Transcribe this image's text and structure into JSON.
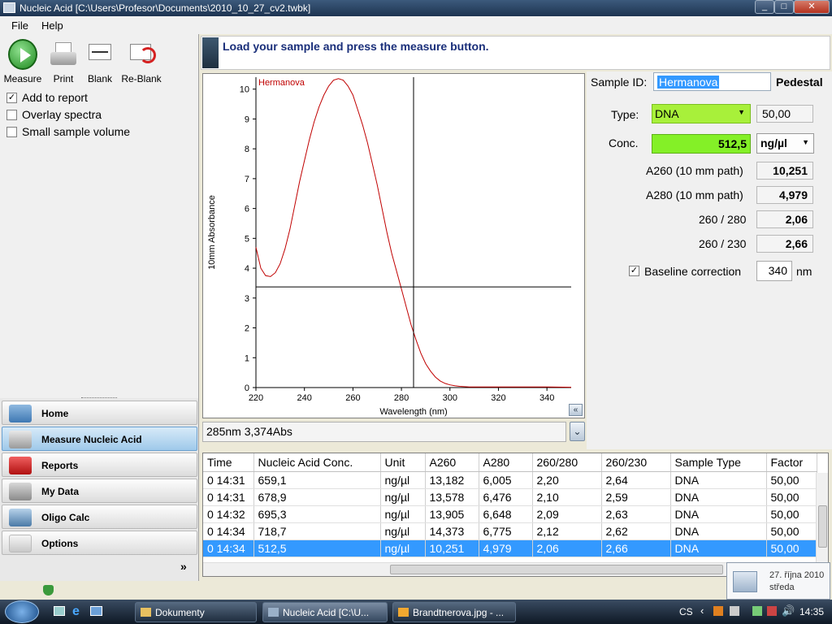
{
  "window": {
    "title": "Nucleic Acid  [C:\\Users\\Profesor\\Documents\\2010_10_27_cv2.twbk]",
    "min": "_",
    "max": "□",
    "close": "✕"
  },
  "menu": [
    "File",
    "Help"
  ],
  "toolbar": {
    "measure": "Measure",
    "print": "Print",
    "blank": "Blank",
    "reblank": "Re-Blank"
  },
  "options": [
    {
      "label": "Add to report",
      "checked": true
    },
    {
      "label": "Overlay spectra",
      "checked": false
    },
    {
      "label": "Small sample volume",
      "checked": false
    }
  ],
  "nav": [
    {
      "label": "Home",
      "active": false
    },
    {
      "label": "Measure Nucleic Acid",
      "active": true
    },
    {
      "label": "Reports",
      "active": false
    },
    {
      "label": "My Data",
      "active": false
    },
    {
      "label": "Oligo Calc",
      "active": false
    },
    {
      "label": "Options",
      "active": false
    }
  ],
  "nav_more": "»",
  "instruction": "Load your sample and press the measure button.",
  "readout": "285nm 3,374Abs",
  "sample": {
    "id_label": "Sample ID:",
    "id_value": "Hermanova",
    "pedestal": "Pedestal",
    "type_label": "Type:",
    "type_value": "DNA",
    "factor": "50,00",
    "conc_label": "Conc.",
    "conc_value": "512,5",
    "unit": "ng/µl",
    "a260_label": "A260 (10 mm path)",
    "a260": "10,251",
    "a280_label": "A280 (10 mm path)",
    "a280": "4,979",
    "r260_280_label": "260 / 280",
    "r260_280": "2,06",
    "r260_230_label": "260 / 230",
    "r260_230": "2,66",
    "baseline_label": "Baseline correction",
    "baseline_value": "340",
    "baseline_unit": "nm"
  },
  "table": {
    "headers": [
      "Time",
      "Nucleic Acid Conc.",
      "Unit",
      "A260",
      "A280",
      "260/280",
      "260/230",
      "Sample Type",
      "Factor"
    ],
    "rows": [
      [
        "0 14:31",
        "659,1",
        "ng/µl",
        "13,182",
        "6,005",
        "2,20",
        "2,64",
        "DNA",
        "50,00"
      ],
      [
        "0 14:31",
        "678,9",
        "ng/µl",
        "13,578",
        "6,476",
        "2,10",
        "2,59",
        "DNA",
        "50,00"
      ],
      [
        "0 14:32",
        "695,3",
        "ng/µl",
        "13,905",
        "6,648",
        "2,09",
        "2,63",
        "DNA",
        "50,00"
      ],
      [
        "0 14:34",
        "718,7",
        "ng/µl",
        "14,373",
        "6,775",
        "2,12",
        "2,62",
        "DNA",
        "50,00"
      ],
      [
        "0 14:34",
        "512,5",
        "ng/µl",
        "10,251",
        "4,979",
        "2,06",
        "2,66",
        "DNA",
        "50,00"
      ]
    ],
    "selected_row": 4
  },
  "taskbar": {
    "items": [
      "Dokumenty",
      "Nucleic Acid  [C:\\U...",
      "Brandtnerova.jpg - ..."
    ],
    "lang": "CS",
    "clock": "14:35",
    "popup_date": "27. října 2010",
    "popup_day": "středa"
  },
  "chart_data": {
    "type": "line",
    "series_label": "Hermanova",
    "xlabel": "Wavelength (nm)",
    "ylabel": "10mm Absorbance",
    "xlim": [
      220,
      350
    ],
    "ylim": [
      0,
      10.4
    ],
    "xticks": [
      220,
      240,
      260,
      280,
      300,
      320,
      340
    ],
    "yticks": [
      0,
      1,
      2,
      3,
      4,
      5,
      6,
      7,
      8,
      9,
      10
    ],
    "cursor": {
      "x": 285,
      "y": 3.374
    },
    "series": [
      {
        "color": "#c00000",
        "x": [
          220,
          222,
          224,
          226,
          228,
          230,
          232,
          234,
          236,
          238,
          240,
          242,
          244,
          246,
          248,
          250,
          252,
          254,
          256,
          258,
          260,
          262,
          264,
          266,
          268,
          270,
          272,
          274,
          276,
          278,
          280,
          282,
          284,
          286,
          288,
          290,
          292,
          294,
          296,
          298,
          300,
          302,
          304,
          306,
          308,
          310,
          315,
          320,
          330,
          340,
          350
        ],
        "y": [
          4.7,
          4.0,
          3.75,
          3.72,
          3.85,
          4.15,
          4.65,
          5.3,
          6.1,
          6.9,
          7.6,
          8.3,
          8.9,
          9.4,
          9.8,
          10.1,
          10.3,
          10.35,
          10.3,
          10.1,
          9.8,
          9.3,
          8.8,
          8.2,
          7.5,
          6.8,
          6.0,
          5.2,
          4.5,
          3.9,
          3.3,
          2.7,
          2.1,
          1.6,
          1.15,
          0.8,
          0.55,
          0.35,
          0.22,
          0.14,
          0.09,
          0.06,
          0.04,
          0.03,
          0.02,
          0.02,
          0.02,
          0.02,
          0.02,
          0.02,
          0.01
        ]
      }
    ]
  }
}
